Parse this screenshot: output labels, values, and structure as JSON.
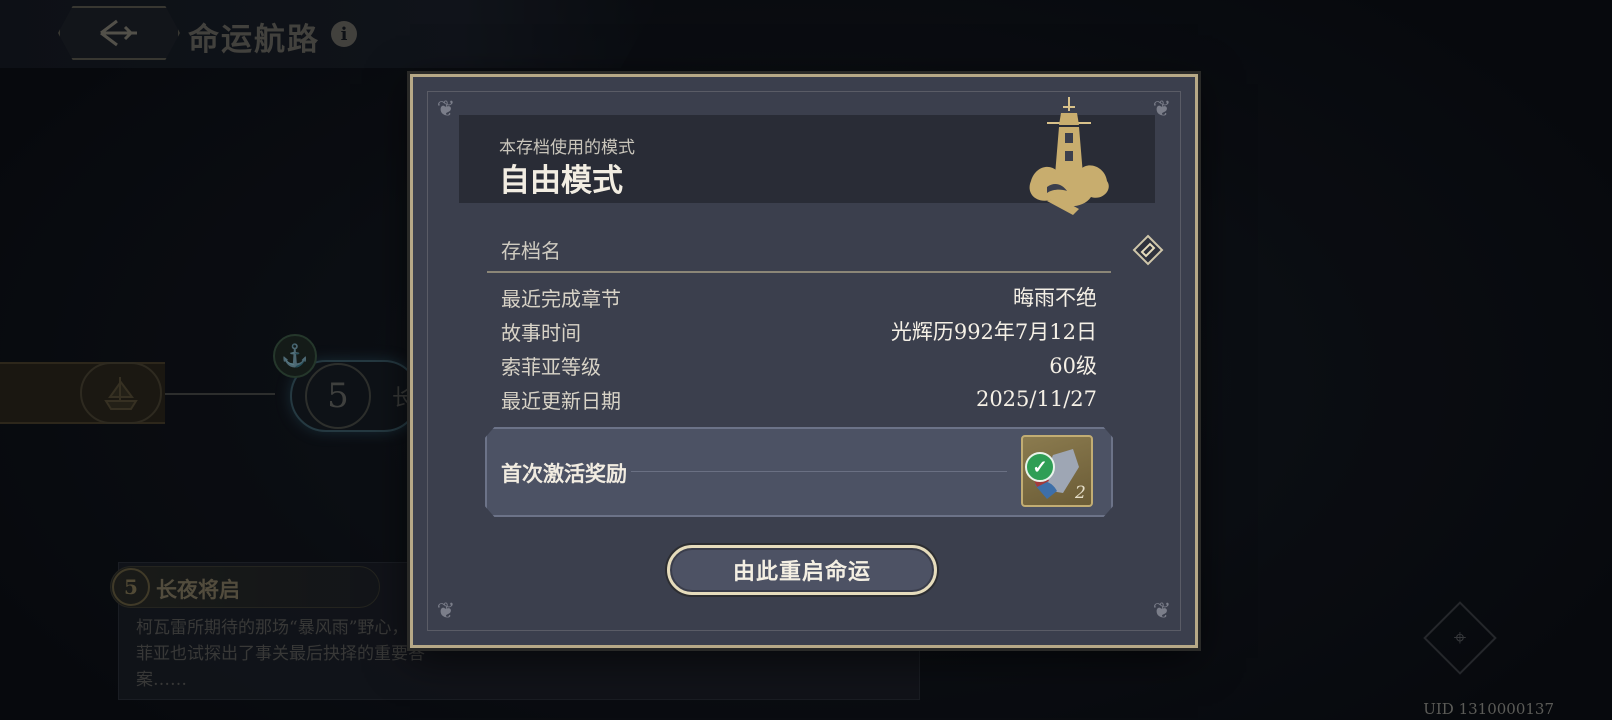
{
  "header": {
    "title": "命运航路",
    "back_icon": "back-arrow-icon",
    "info_icon": "info-icon"
  },
  "map": {
    "chapter_number": "5",
    "chapter_partial_label": "长",
    "anchor_icon": "anchor-icon"
  },
  "chapter_info": {
    "number": "5",
    "title": "长夜将启",
    "description": "柯瓦雷所期待的那场“暴风雨”野心，索菲亚也试探出了事关最后抉择的重要答案……"
  },
  "dialog": {
    "mode_label": "本存档使用的模式",
    "mode_name": "自由模式",
    "save_name_label": "存档名",
    "rows": [
      {
        "key": "最近完成章节",
        "value": "晦雨不绝"
      },
      {
        "key": "故事时间",
        "value": "光辉历992年7月12日"
      },
      {
        "key": "索菲亚等级",
        "value": "60级"
      },
      {
        "key": "最近更新日期",
        "value": "2025/11/27"
      }
    ],
    "reward": {
      "label": "首次激活奖励",
      "count": "2",
      "claimed": true
    },
    "restart_button": "由此重启命运"
  },
  "footer": {
    "uid": "UID 1310000137"
  },
  "colors": {
    "frame_gold": "#b7a987",
    "dialog_bg": "#3b3f4d",
    "reward_check": "#2f9e55"
  }
}
